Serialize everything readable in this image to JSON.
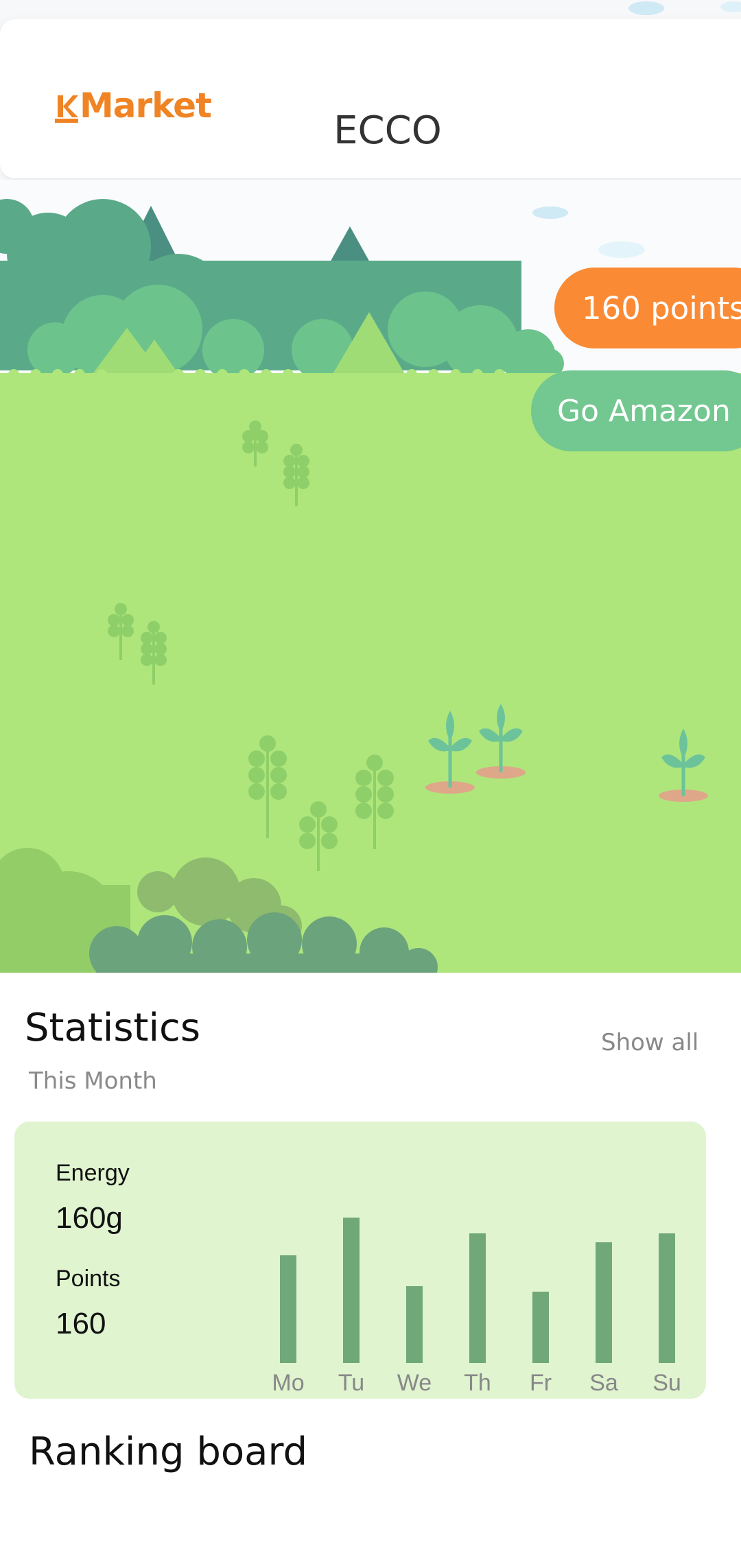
{
  "header": {
    "brand": "Market",
    "brand_color": "#f08424",
    "store_name": "ECCO"
  },
  "actions": {
    "points_label": "160 points",
    "store_link_label": "Go Amazon"
  },
  "statistics": {
    "title": "Statistics",
    "show_all": "Show all",
    "period": "This Month",
    "energy_label": "Energy",
    "energy_value": "160g",
    "points_label": "Points",
    "points_value": "160"
  },
  "chart_data": {
    "type": "bar",
    "categories": [
      "Mo",
      "Tu",
      "We",
      "Th",
      "Fr",
      "Sa",
      "Su"
    ],
    "values": [
      0.74,
      1.0,
      0.53,
      0.89,
      0.49,
      0.83,
      0.89
    ],
    "color": "#70a87a"
  },
  "ranking": {
    "title": "Ranking board"
  },
  "colors": {
    "points_pill": "#fb8a35",
    "store_pill": "#73c790",
    "grass": "#aee67b",
    "stats_card": "#dff4cf"
  }
}
